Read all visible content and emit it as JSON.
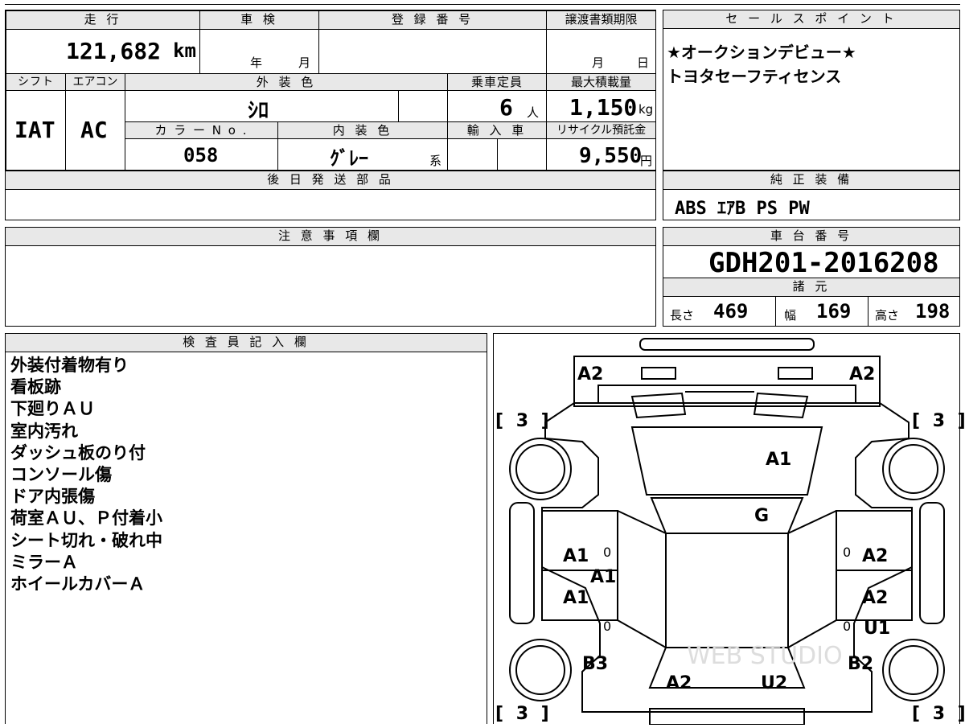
{
  "header": {
    "mileage_label": "走 行",
    "inspection_label": "車 検",
    "registration_label": "登 録 番 号",
    "transfer_deadline_label": "譲渡書類期限",
    "selling_points_label": "セ ー ル ス ポ イ ン ト"
  },
  "mileage": {
    "value": "121,682",
    "unit": "km"
  },
  "inspection": {
    "year_unit": "年",
    "month_unit": "月"
  },
  "transfer": {
    "month_unit": "月",
    "day_unit": "日"
  },
  "selling_points": [
    "★オークションデビュー★",
    "トヨタセーフティセンス"
  ],
  "specs_labels": {
    "shift": "シフト",
    "aircon": "エアコン",
    "exterior_color": "外 装 色",
    "capacity": "乗車定員",
    "max_load": "最大積載量",
    "color_no": "カ ラ ー N o .",
    "interior_color": "内 装 色",
    "import": "輸 入 車",
    "recycle_fee": "リサイクル預託金"
  },
  "specs": {
    "shift": "IAT",
    "aircon": "AC",
    "exterior_color": "ｼﾛ",
    "capacity": "6",
    "capacity_unit": "人",
    "max_load": "1,150",
    "max_load_unit": "kg",
    "color_no": "058",
    "interior_color": "ｸﾞﾚｰ",
    "interior_suffix": "系",
    "recycle_fee": "9,550",
    "recycle_unit": "円"
  },
  "later_parts_label": "後 日 発 送 部 品",
  "genuine_equipment_label": "純 正 装 備",
  "genuine_equipment": "ABS ｴｱB PS PW",
  "notes_label": "注 意 事 項 欄",
  "chassis_label": "車 台 番 号",
  "chassis_number": "GDH201-2016208",
  "dimensions_label": "諸 元",
  "dimensions": {
    "length_label": "長さ",
    "length": "469",
    "width_label": "幅",
    "width": "169",
    "height_label": "高さ",
    "height": "198"
  },
  "inspector_label": "検 査 員 記 入 欄",
  "inspector_notes": [
    "外装付着物有り",
    "看板跡",
    "下廻りＡＵ",
    "室内汚れ",
    "ダッシュ板のり付",
    "コンソール傷",
    "ドア内張傷",
    "荷室ＡＵ、Ｐ付着小",
    "シート切れ・破れ中",
    "ミラーＡ",
    "ホイールカバーＡ"
  ],
  "diagram": {
    "front_left": "A2",
    "front_right": "A2",
    "tire_fl": "[ 3 ]",
    "tire_fr": "[ 3 ]",
    "tire_rl": "[ 3 ]",
    "tire_rr": "[ 3 ]",
    "hood": "A1",
    "windshield": "G",
    "left_front_door": "A1",
    "left_pillar": "A1",
    "left_rear_door": "A1",
    "right_front_door": "A2",
    "right_rear_door": "A2",
    "right_rear_panel": "U1",
    "left_rear_fender": "B3",
    "right_rear_fender": "B2",
    "rear_left": "A2",
    "rear_right": "U2",
    "zero": "0",
    "watermark": "WEB STUDIO"
  }
}
